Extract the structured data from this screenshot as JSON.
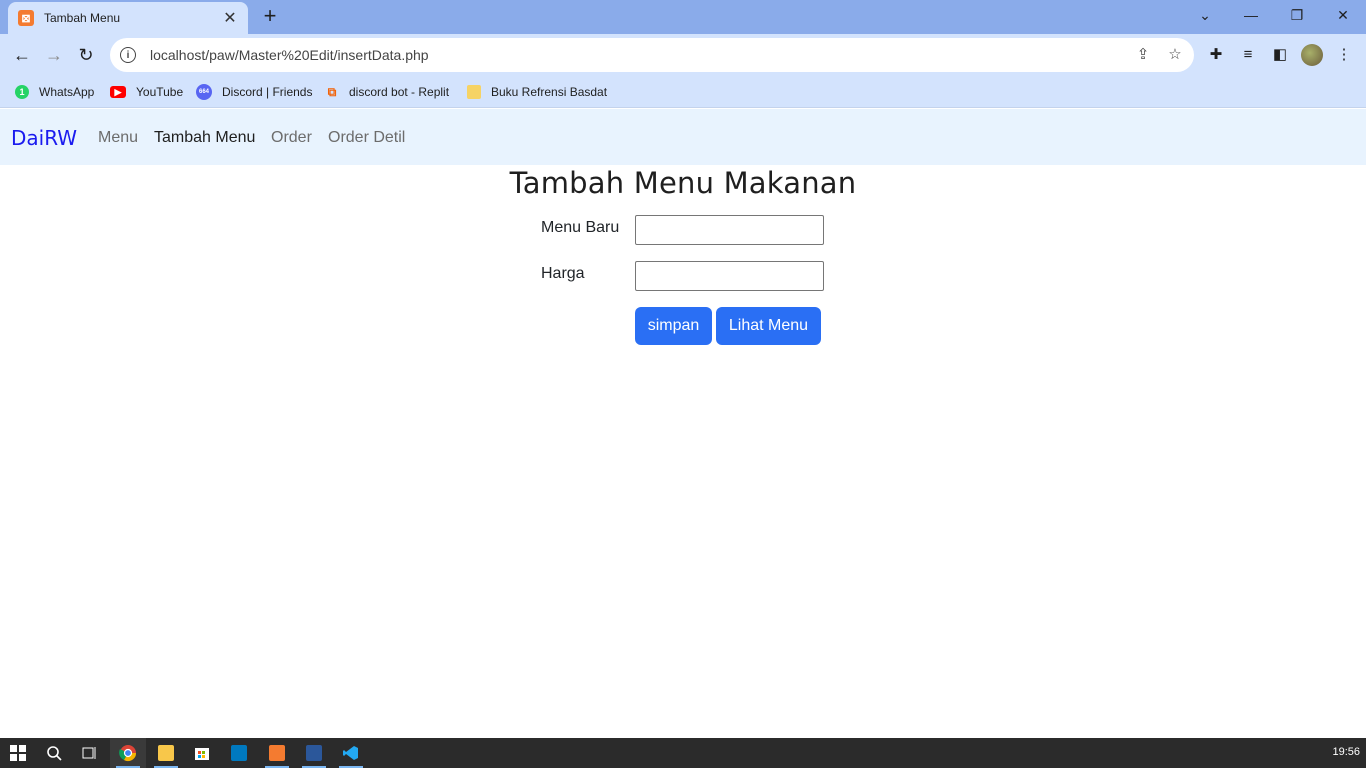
{
  "browser": {
    "tab_title": "Tambah Menu",
    "tab_favicon": "xampp-icon",
    "new_tab_symbol": "+",
    "url": "localhost/paw/Master%20Edit/insertData.php",
    "bookmarks": [
      {
        "label": "WhatsApp",
        "icon": "whatsapp-icon",
        "badge": "1",
        "color": "#25d366"
      },
      {
        "label": "YouTube",
        "icon": "youtube-icon",
        "color": "#ff0000"
      },
      {
        "label": "Discord | Friends",
        "icon": "discord-icon",
        "badge": "664",
        "color": "#5865f2"
      },
      {
        "label": "discord bot - Replit",
        "icon": "replit-icon",
        "color": "#f26207"
      },
      {
        "label": "Buku Refrensi Basdat",
        "icon": "folder-icon",
        "color": "#f6d365"
      }
    ]
  },
  "navbar": {
    "brand": "DaiRW",
    "links": [
      "Menu",
      "Tambah Menu",
      "Order",
      "Order Detil"
    ],
    "active_index": 1
  },
  "form": {
    "title": "Tambah Menu Makanan",
    "fields": [
      {
        "label": "Menu Baru",
        "value": ""
      },
      {
        "label": "Harga",
        "value": ""
      }
    ],
    "buttons": {
      "save": "simpan",
      "view": "Lihat Menu"
    },
    "button_color": "#2a6ff4"
  },
  "taskbar": {
    "time": "19:56"
  }
}
